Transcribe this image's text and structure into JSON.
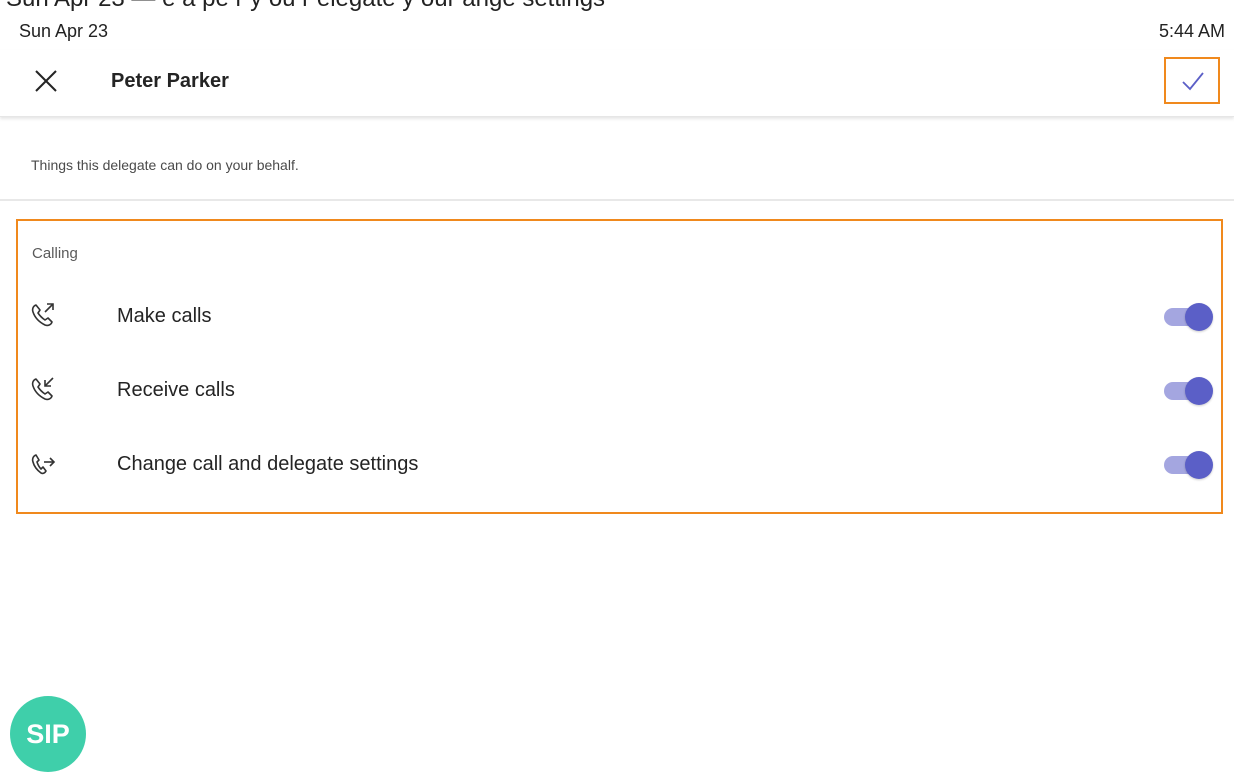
{
  "top_strip": {
    "text": "Sun Apr 23 — e a pe r y ou r elegate y our ange settings"
  },
  "status_bar": {
    "date": "Sun Apr 23",
    "time": "5:44 AM"
  },
  "header": {
    "title": "Peter Parker",
    "close_icon": "close-icon",
    "save_icon": "checkmark-icon",
    "accent_color": "#5b5fc7",
    "highlight_color": "#f0891d"
  },
  "description": "Things this delegate can do on your behalf.",
  "calling": {
    "section_label": "Calling",
    "permissions": [
      {
        "label": "Make calls",
        "icon": "outgoing-call-icon",
        "enabled": true
      },
      {
        "label": "Receive calls",
        "icon": "incoming-call-icon",
        "enabled": true
      },
      {
        "label": "Change call and delegate settings",
        "icon": "call-forward-icon",
        "enabled": true
      }
    ]
  },
  "badge": {
    "text": "SIP",
    "color": "#3fcfaa"
  }
}
